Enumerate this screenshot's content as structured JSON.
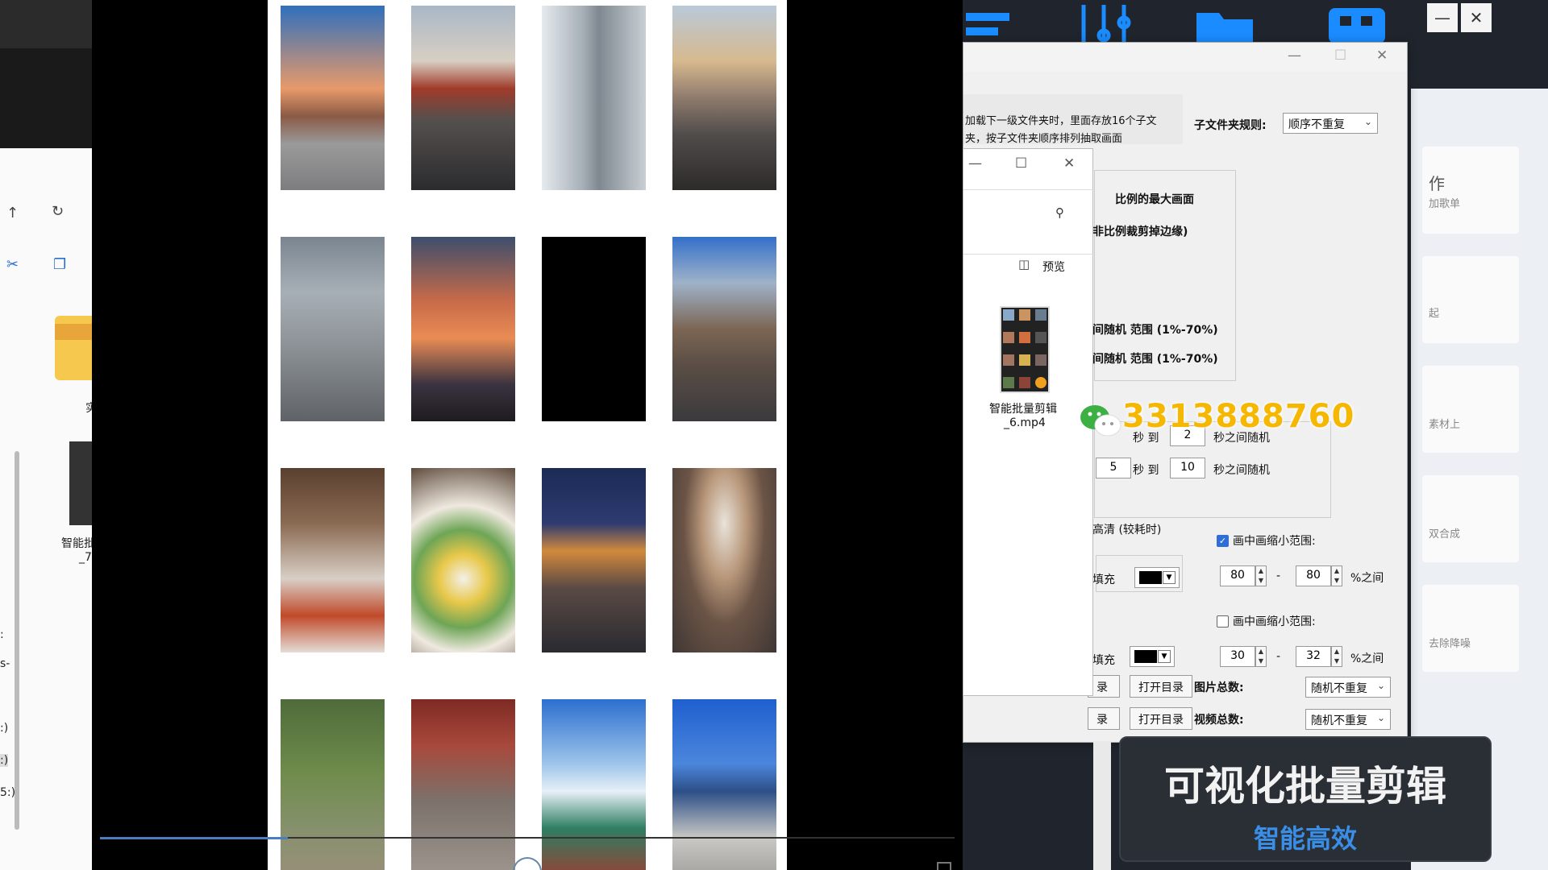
{
  "explorer": {
    "folder_label": "实",
    "file_label_line1": "智能批",
    "file_label_line2": "_7.",
    "side_labels": [
      ":",
      "s-",
      ":)",
      ":)",
      "5:)"
    ]
  },
  "player": {
    "progress_fraction": 0.22
  },
  "settings": {
    "info_line1": "加载下一级文件夹时，里面存放16个子文",
    "info_line2": "夹，按子文件夹顺序排列抽取画面",
    "subfolder_rule_label": "子文件夹规则:",
    "subfolder_rule_value": "顺序不重复",
    "option_max_frame": "比例的最大画面",
    "option_crop": "非比例裁剪掉边缘)",
    "random_range_1": "间随机 范围 (1%-70%)",
    "random_range_2": "间随机 范围 (1%-70%)",
    "sec_row1": {
      "to": "秒 到",
      "value_b": "2",
      "suffix": "秒之间随机"
    },
    "sec_row2": {
      "value_a": "5",
      "to": "秒 到",
      "value_b": "10",
      "suffix": "秒之间随机"
    },
    "hd_label": "高清 (较耗时)",
    "pip1": {
      "label": "画中画缩小范围:",
      "checked": "✓",
      "fill_label": "填充",
      "min": "80",
      "max": "80",
      "dash": "-",
      "unit": "%之间"
    },
    "pip2": {
      "label": "画中画缩小范围:",
      "fill_label": "填充",
      "min": "30",
      "max": "32",
      "dash": "-",
      "unit": "%之间"
    },
    "dir_row1": {
      "left": "录",
      "button": "打开目录",
      "label": "图片总数:",
      "value": "随机不重复"
    },
    "dir_row2": {
      "left": "录",
      "button": "打开目录",
      "label": "视频总数:",
      "value": "随机不重复"
    }
  },
  "explorer2": {
    "preview_label": "预览",
    "file_name_line1": "智能批量剪辑",
    "file_name_line2": "_6.mp4"
  },
  "app": {
    "feature_labels": [
      "作",
      "加歌单",
      "起",
      "素材上",
      "双合成",
      "去除降噪"
    ],
    "minimize": "—",
    "close": "✕"
  },
  "watermark": {
    "phone": "3313888760"
  },
  "banner": {
    "title": "可视化批量剪辑",
    "subtitle": "智能高效"
  },
  "colors": {
    "accent_blue": "#2f6ed8",
    "banner_blue": "#3a8ee6",
    "phone_gold": "#f5b700"
  }
}
